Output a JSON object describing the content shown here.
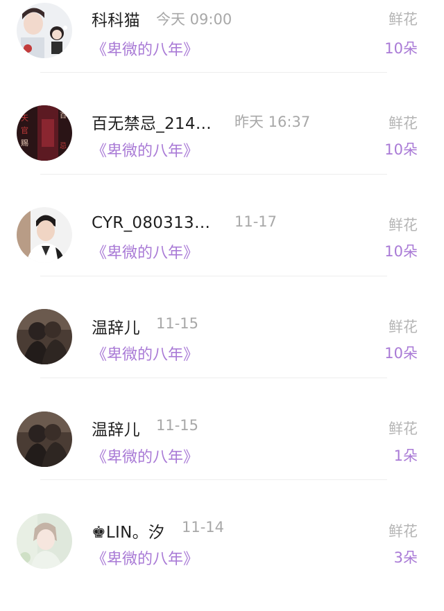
{
  "gift_records": [
    {
      "name": "科科猫",
      "time": "今天 09:00",
      "book": "《卑微的八年》",
      "gift_label": "鲜花",
      "count": "10朵"
    },
    {
      "name": "百无禁忌_214…",
      "time": "昨天 16:37",
      "book": "《卑微的八年》",
      "gift_label": "鲜花",
      "count": "10朵"
    },
    {
      "name": "CYR_080313…",
      "time": "11-17",
      "book": "《卑微的八年》",
      "gift_label": "鲜花",
      "count": "10朵"
    },
    {
      "name": "温辞儿",
      "time": "11-15",
      "book": "《卑微的八年》",
      "gift_label": "鲜花",
      "count": "10朵"
    },
    {
      "name": "温辞儿",
      "time": "11-15",
      "book": "《卑微的八年》",
      "gift_label": "鲜花",
      "count": "1朵"
    },
    {
      "name": "♚LIN。汐",
      "time": "11-14",
      "book": "《卑微的八年》",
      "gift_label": "鲜花",
      "count": "3朵"
    }
  ],
  "colors": {
    "accent": "#a97ad6",
    "muted": "#a8a8a8",
    "text": "#1f1f1f"
  }
}
